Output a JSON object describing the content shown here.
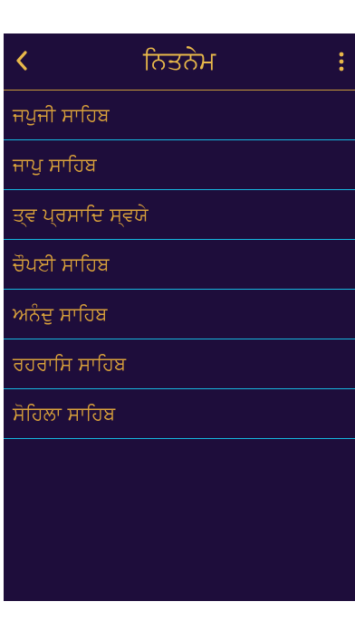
{
  "header": {
    "title": "ਨਿਤਨੇਮ",
    "back_icon": "chevron-left-icon",
    "menu_icon": "more-vertical-icon"
  },
  "list": {
    "items": [
      {
        "label": "ਜਪੁਜੀ ਸਾਹਿਬ"
      },
      {
        "label": "ਜਾਪੁ ਸਾਹਿਬ"
      },
      {
        "label": "ਤ੍ਵ ਪ੍ਰਸਾਦਿ ਸ੍ਵਯੇ"
      },
      {
        "label": "ਚੌਪਈ ਸਾਹਿਬ"
      },
      {
        "label": "ਅਨੰਦੁ ਸਾਹਿਬ"
      },
      {
        "label": "ਰਹਰਾਸਿ ਸਾਹਿਬ"
      },
      {
        "label": "ਸੋਹਿਲਾ ਸਾਹਿਬ"
      }
    ]
  },
  "colors": {
    "background": "#1e0d3b",
    "accent": "#e8b84a",
    "divider": "#16b8e0"
  }
}
